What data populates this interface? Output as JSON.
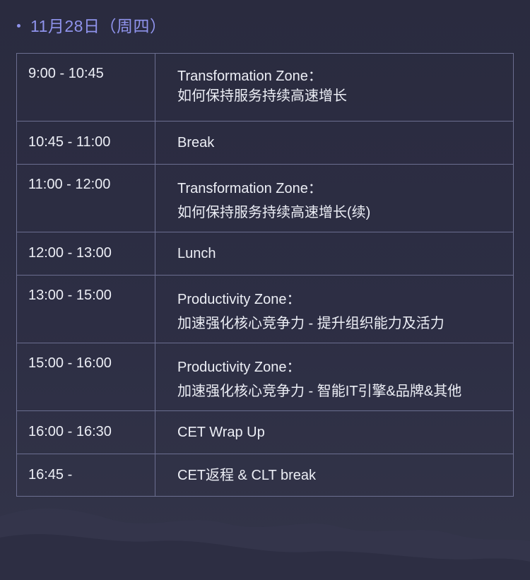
{
  "header": {
    "date": "11月28日（周四）"
  },
  "schedule": [
    {
      "time": "9:00 - 10:45",
      "title": "Transformation Zone：",
      "subtitle": "如何保持服务持续高速增长"
    },
    {
      "time": "10:45 - 11:00",
      "title": "Break",
      "subtitle": ""
    },
    {
      "time": "11:00 - 12:00",
      "title": "Transformation Zone：",
      "subtitle": "如何保持服务持续高速增长(续)"
    },
    {
      "time": "12:00 - 13:00",
      "title": "Lunch",
      "subtitle": ""
    },
    {
      "time": "13:00 - 15:00",
      "title": "Productivity Zone：",
      "subtitle": "加速强化核心竞争力 - 提升组织能力及活力"
    },
    {
      "time": "15:00 - 16:00",
      "title": "Productivity Zone：",
      "subtitle": "加速强化核心竞争力 - 智能IT引擎&品牌&其他"
    },
    {
      "time": "16:00 - 16:30",
      "title": "CET Wrap Up",
      "subtitle": ""
    },
    {
      "time": "16:45 -",
      "title": "CET返程 & CLT break",
      "subtitle": ""
    }
  ]
}
